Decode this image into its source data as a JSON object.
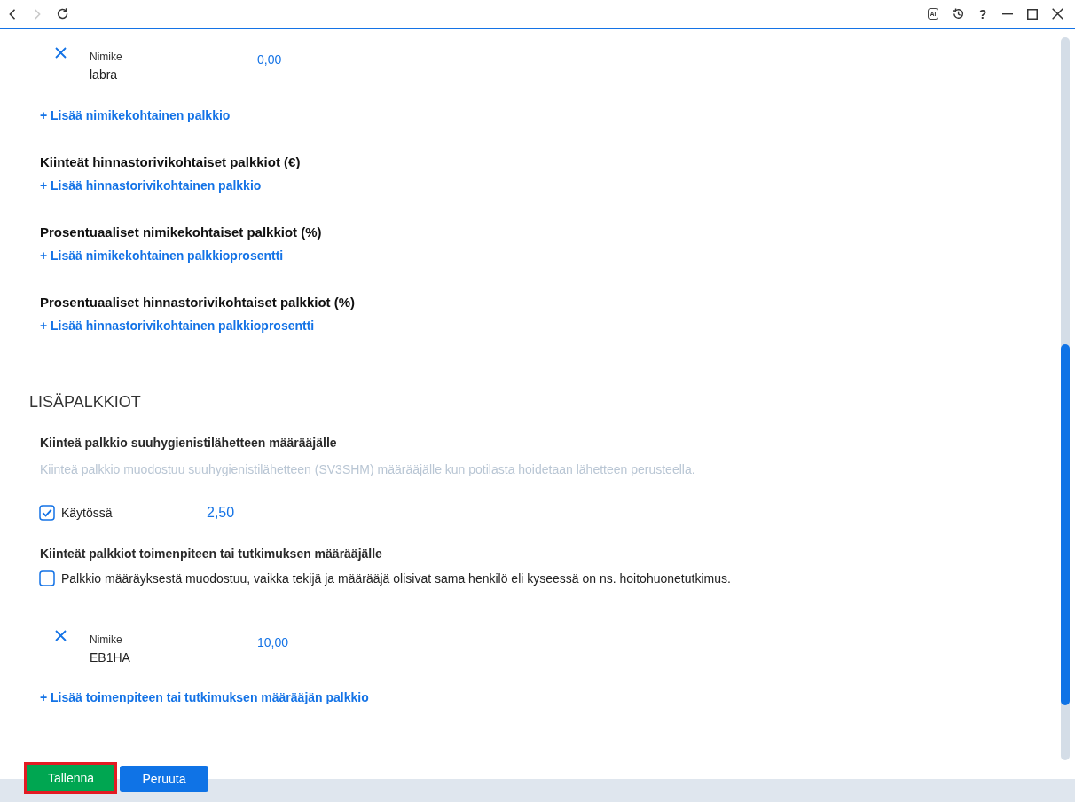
{
  "toolbar": {
    "nav": [
      {
        "kind": "back",
        "disabled": false
      },
      {
        "kind": "forward",
        "disabled": true
      },
      {
        "kind": "reload",
        "disabled": false
      }
    ],
    "actions": [
      {
        "kind": "ai",
        "label": "AI"
      },
      {
        "kind": "history"
      },
      {
        "kind": "help",
        "label": "?"
      },
      {
        "kind": "minimize"
      },
      {
        "kind": "maximize"
      },
      {
        "kind": "close"
      }
    ]
  },
  "item_fees": {
    "rows": [
      {
        "label": "Nimike",
        "item": "labra",
        "amount": "0,00"
      }
    ],
    "add_link": "+ Lisää nimikekohtainen palkkio"
  },
  "fee_groups": [
    {
      "title": "Kiinteät hinnastorivikohtaiset palkkiot (€)",
      "add_link": "+ Lisää hinnastorivikohtainen palkkio"
    },
    {
      "title": "Prosentuaaliset nimikekohtaiset palkkiot (%)",
      "add_link": "+ Lisää nimikekohtainen palkkioprosentti"
    },
    {
      "title": "Prosentuaaliset hinnastorivikohtaiset palkkiot (%)",
      "add_link": "+ Lisää hinnastorivikohtainen palkkioprosentti"
    }
  ],
  "extra_fees": {
    "title": "LISÄPALKKIOT",
    "referral_fee": {
      "title": "Kiinteä palkkio suuhygienistilähetteen määrääjälle",
      "description": "Kiinteä palkkio muodostuu suuhygienistilähetteen (SV3SHM) määrääjälle kun potilasta hoidetaan lähetteen perusteella.",
      "option": {
        "label": "Käytössä",
        "checked": true
      },
      "amount": "2,50"
    },
    "procedure_fee": {
      "title": "Kiinteät palkkiot toimenpiteen tai tutkimuksen määrääjälle",
      "option": {
        "label": "Palkkio määräyksestä muodostuu, vaikka tekijä ja määrääjä olisivat sama henkilö eli kyseessä on ns. hoitohuonetutkimus.",
        "checked": false
      },
      "rows": [
        {
          "label": "Nimike",
          "item": "EB1HA",
          "amount": "10,00"
        }
      ],
      "add_link": "+ Lisää toimenpiteen tai tutkimuksen määrääjän palkkio"
    }
  },
  "footer": {
    "buttons": [
      {
        "kind": "save",
        "label": "Tallenna",
        "highlighted": true
      },
      {
        "kind": "cancel",
        "label": "Peruuta",
        "highlighted": false
      }
    ]
  }
}
